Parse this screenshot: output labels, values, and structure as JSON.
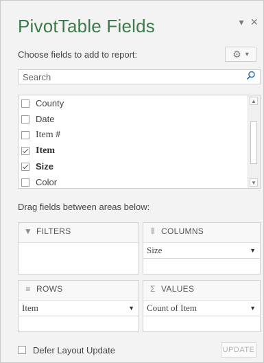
{
  "pane": {
    "title": "PivotTable Fields",
    "controls": {
      "dropdown_glyph": "▾",
      "close_glyph": "×"
    }
  },
  "choose": {
    "label": "Choose fields to add to report:",
    "gear_glyph": "⚙",
    "caret_glyph": "▾"
  },
  "search": {
    "placeholder": "Search",
    "value": "",
    "icon": "search-icon"
  },
  "fields": [
    {
      "label": "County",
      "checked": false
    },
    {
      "label": "Date",
      "checked": false
    },
    {
      "label": "Item #",
      "checked": false
    },
    {
      "label": "Item",
      "checked": true
    },
    {
      "label": "Size",
      "checked": true
    },
    {
      "label": "Color",
      "checked": false
    }
  ],
  "drag_label": "Drag fields between areas below:",
  "areas": {
    "filters": {
      "label": "FILTERS",
      "icon": "filter-icon",
      "icon_glyph": "▼",
      "items": []
    },
    "columns": {
      "label": "COLUMNS",
      "icon": "columns-icon",
      "icon_glyph": "⦀",
      "items": [
        "Size"
      ]
    },
    "rows": {
      "label": "ROWS",
      "icon": "rows-icon",
      "icon_glyph": "≡",
      "items": [
        "Item"
      ]
    },
    "values": {
      "label": "VALUES",
      "icon": "sigma-icon",
      "icon_glyph": "Σ",
      "items": [
        "Count of Item"
      ]
    }
  },
  "footer": {
    "defer_label": "Defer Layout Update",
    "defer_checked": false,
    "update_label": "UPDATE"
  }
}
